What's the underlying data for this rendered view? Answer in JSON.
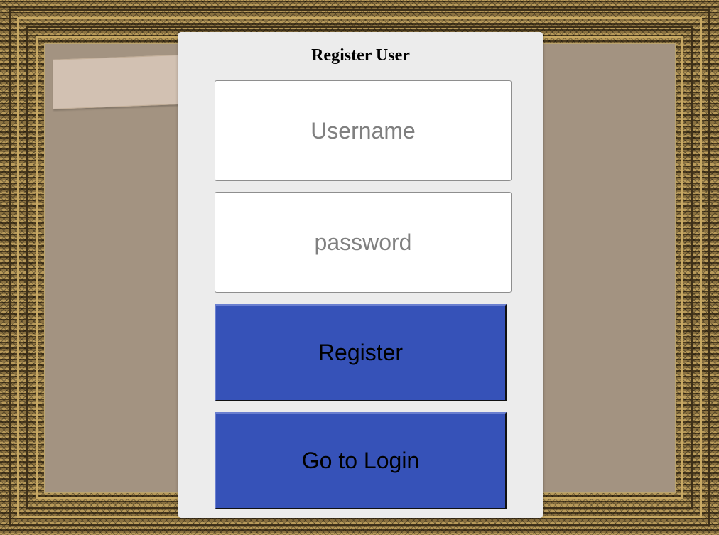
{
  "dialog": {
    "title": "Register User"
  },
  "form": {
    "username_placeholder": "Username",
    "username_value": "",
    "password_placeholder": "password",
    "password_value": ""
  },
  "buttons": {
    "register_label": "Register",
    "login_label": "Go to Login"
  },
  "colors": {
    "button_bg": "#3652b8",
    "dialog_bg": "#ececec",
    "wall_bg": "#a39381"
  }
}
